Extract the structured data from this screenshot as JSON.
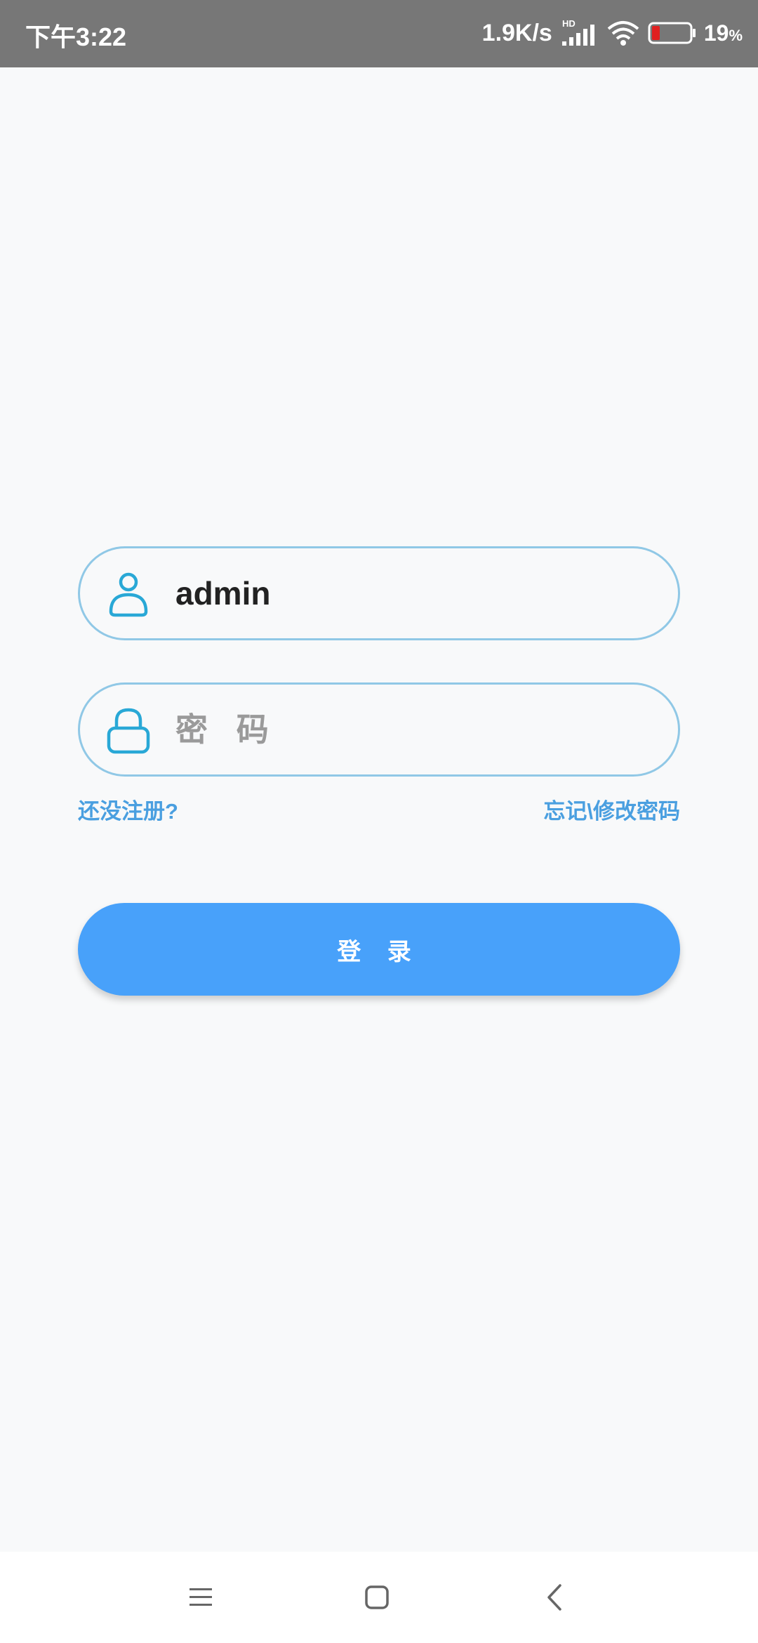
{
  "status_bar": {
    "time": "下午3:22",
    "network_speed": "1.9K/s",
    "network_type": "HD",
    "battery_percent": "19",
    "battery_unit": "%",
    "battery_color": "#e02020"
  },
  "login_form": {
    "username": {
      "value": "admin",
      "icon": "user-icon"
    },
    "password": {
      "placeholder": "密 码",
      "icon": "lock-icon"
    },
    "register_link": "还没注册?",
    "forgot_link": "忘记\\修改密码",
    "login_button": "登 录",
    "accent_color": "#48a1fa",
    "icon_color": "#29a8d6"
  },
  "nav_bar": {
    "buttons": [
      "menu-icon",
      "home-icon",
      "back-icon"
    ]
  }
}
